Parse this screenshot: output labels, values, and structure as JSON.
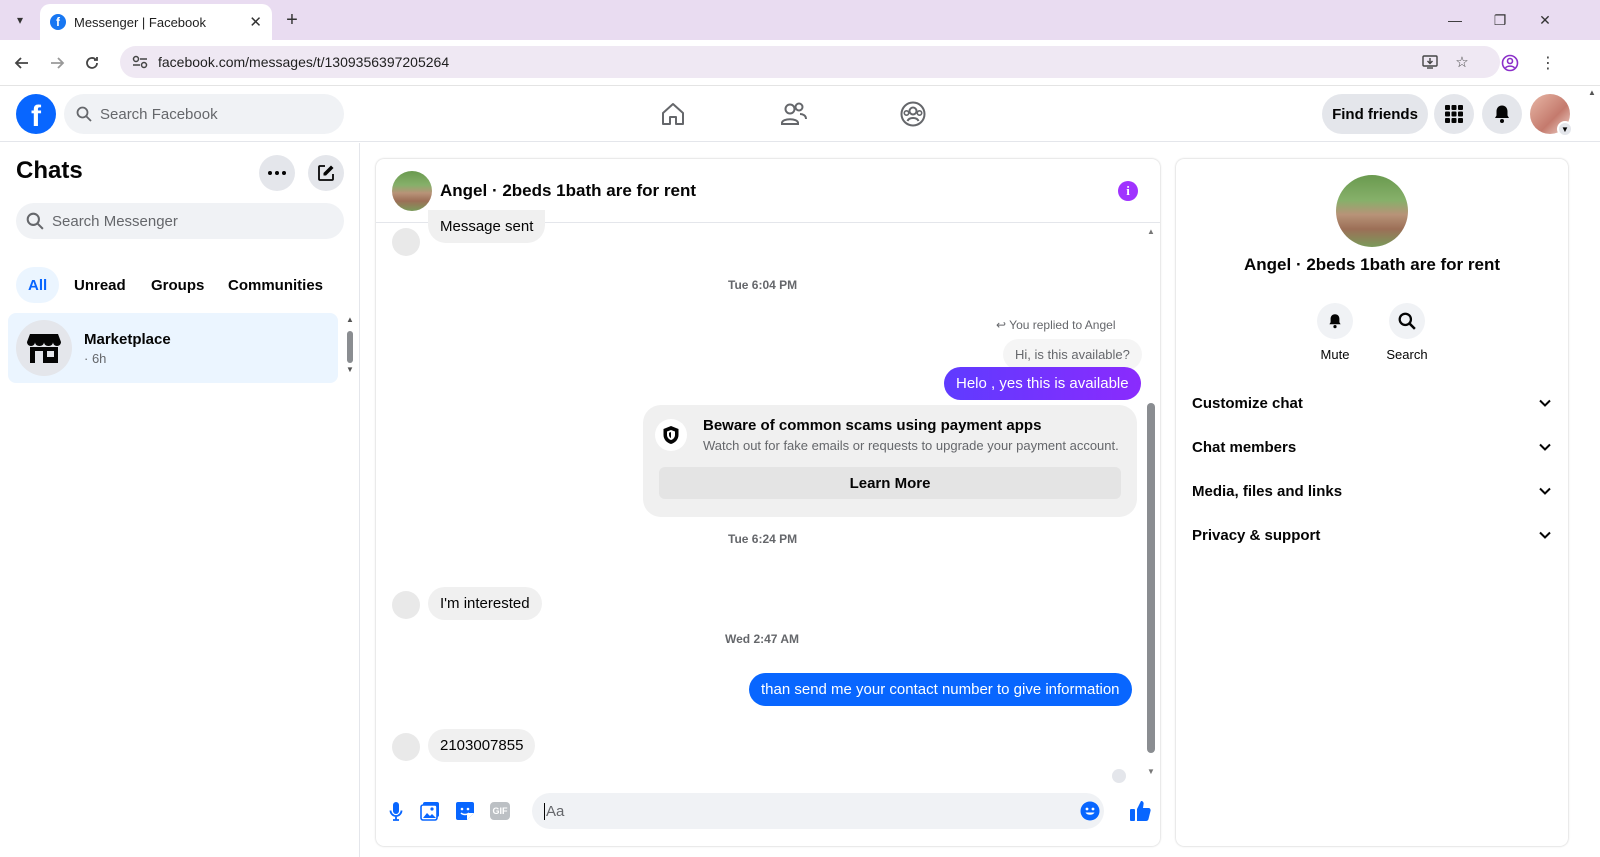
{
  "browser": {
    "tab_title": "Messenger | Facebook",
    "url": "facebook.com/messages/t/1309356397205264"
  },
  "fb": {
    "logo_letter": "f",
    "search_placeholder": "Search Facebook",
    "find_friends_label": "Find friends"
  },
  "sidebar": {
    "title": "Chats",
    "search_placeholder": "Search Messenger",
    "filters": [
      "All",
      "Unread",
      "Groups",
      "Communities"
    ],
    "active_filter": "All",
    "chats": [
      {
        "name": "Marketplace",
        "time": "· 6h"
      }
    ]
  },
  "chat": {
    "title": "Angel · 2beds 1bath are for rent",
    "messages": {
      "m1": "Message sent",
      "ts1": "Tue 6:04 PM",
      "replied_label": "You replied to Angel",
      "quoted": "Hi, is this available?",
      "m2": "Helo , yes this is available",
      "ts2": "Tue 6:24 PM",
      "m3": "I'm interested",
      "ts3": "Wed 2:47 AM",
      "m4": "than send me your contact number to give information",
      "m5": "2103007855"
    },
    "scam_notice": {
      "title": "Beware of common scams using payment apps",
      "description": "Watch out for fake emails or requests to upgrade your payment account.",
      "button": "Learn More"
    },
    "composer": {
      "placeholder": "Aa",
      "gif_label": "GIF"
    }
  },
  "info_panel": {
    "name": "Angel · 2beds 1bath are for rent",
    "actions": [
      "Mute",
      "Search"
    ],
    "sections": [
      "Customize chat",
      "Chat members",
      "Media, files and links",
      "Privacy & support"
    ]
  },
  "colors": {
    "fb_blue": "#0866ff",
    "outgoing_purple": "#7a2eff",
    "info_purple": "#a033ff"
  }
}
